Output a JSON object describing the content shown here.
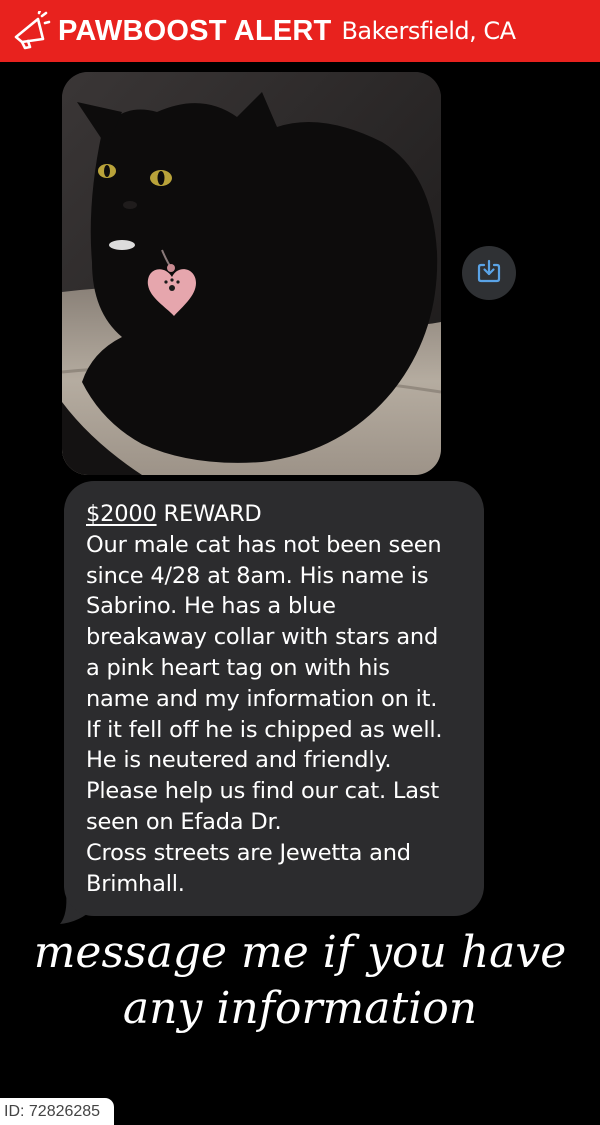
{
  "header": {
    "title": "PAWBOOST ALERT",
    "location": "Bakersfield, CA",
    "icon": "megaphone-icon",
    "background": "#e8221e"
  },
  "photo": {
    "description_icon": "cat-photo"
  },
  "save_button": {
    "icon": "download-icon",
    "accent": "#5aa3e6"
  },
  "message": {
    "reward_amount": "$2000",
    "reward_word": " REWARD",
    "lines": [
      "Our male cat has not been seen",
      "since 4/28 at 8am. His name is",
      "Sabrino. He has a blue",
      "breakaway collar with stars and",
      "a pink heart tag on with his",
      "name and my information on it.",
      "If it fell off he is chipped as well.",
      "He is neutered and friendly.",
      "Please help us find our cat. Last",
      "seen on Efada Dr.",
      "Cross streets are Jewetta and",
      "Brimhall."
    ]
  },
  "caption": {
    "line1": "message me if you have",
    "line2": "any information"
  },
  "footer": {
    "id_label": "ID: 72826285"
  }
}
